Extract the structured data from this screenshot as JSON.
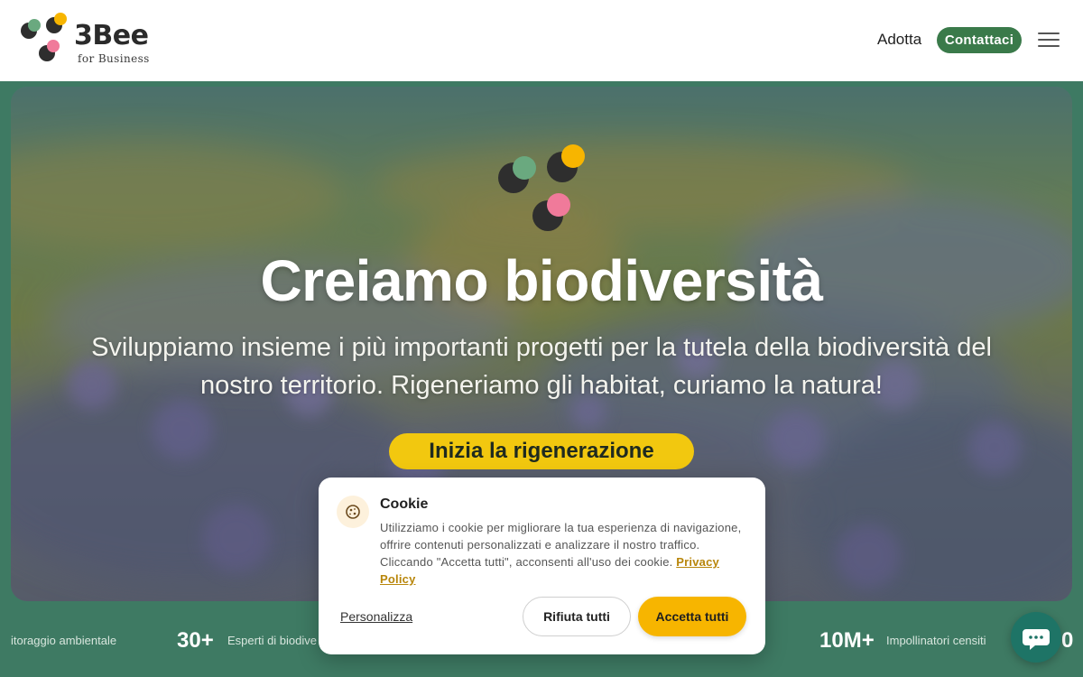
{
  "header": {
    "logo_word": "3Bee",
    "logo_sub": "for Business",
    "nav_adotta": "Adotta",
    "nav_contact": "Contattaci",
    "menu_icon": "hamburger-menu-icon"
  },
  "hero": {
    "title": "Creiamo biodiversità",
    "subtitle": "Sviluppiamo insieme i più importanti progetti per la tutela della biodiversità del nostro territorio. Rigeneriamo gli habitat, curiamo la natura!",
    "cta": "Inizia la rigenerazione"
  },
  "stats": [
    {
      "number": "",
      "label": "itoraggio ambientale"
    },
    {
      "number": "30+",
      "label": "Esperti di biodive"
    },
    {
      "number": "10M+",
      "label": "Impollinatori censiti"
    },
    {
      "number": "0",
      "label": ""
    }
  ],
  "cookie": {
    "title": "Cookie",
    "text": "Utilizziamo i cookie per migliorare la tua esperienza di navigazione, offrire contenuti personalizzati e analizzare il nostro traffico. Cliccando \"Accetta tutti\", acconsenti all'uso dei cookie.",
    "link": "Privacy Policy",
    "customize": "Personalizza",
    "reject": "Rifiuta tutti",
    "accept": "Accetta tutti",
    "icon": "cookie-icon"
  },
  "chat": {
    "icon": "chat-bubble-icon"
  },
  "colors": {
    "brand_green": "#3a7a4a",
    "accent_yellow": "#f2c80f",
    "accept_orange": "#f7b500",
    "chat_teal": "#1e7466",
    "dot_green": "#6aa97f",
    "dot_yellow": "#f7b500",
    "dot_pink": "#f07a9a",
    "dot_dark": "#2e2e2e"
  }
}
